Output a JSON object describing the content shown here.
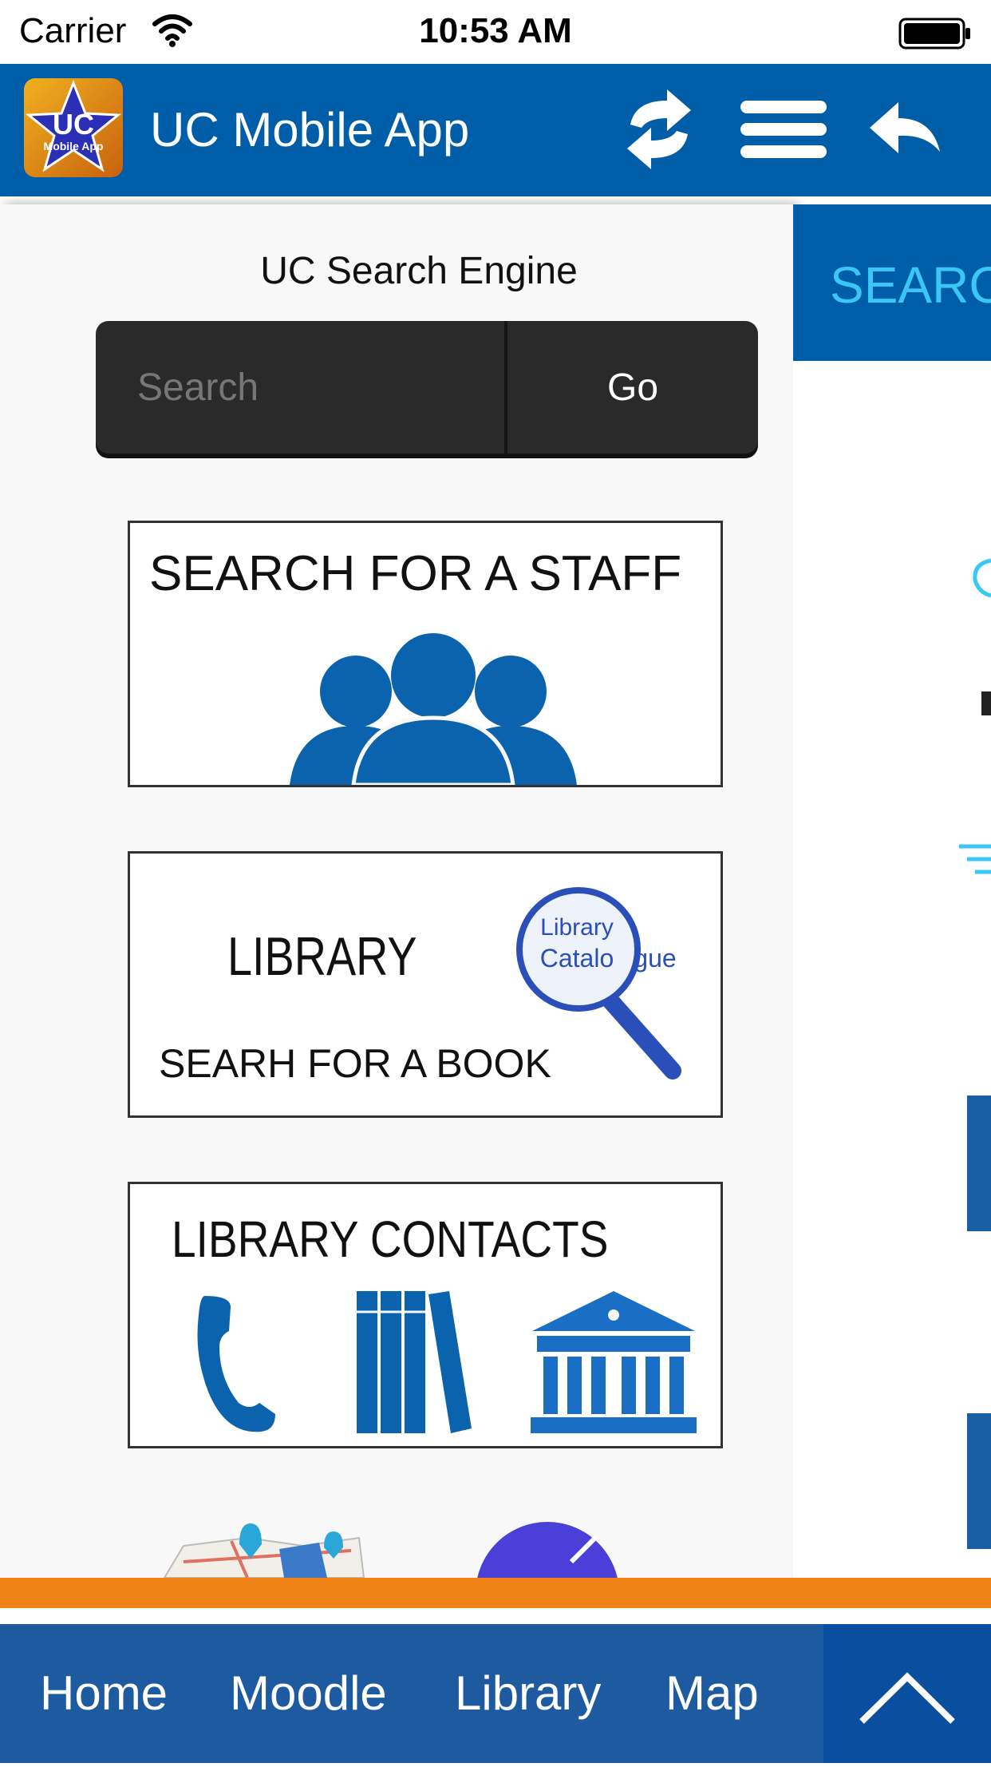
{
  "status_bar": {
    "carrier": "Carrier",
    "time": "10:53 AM"
  },
  "header": {
    "title": "UC Mobile App",
    "logo_text_1": "UC",
    "logo_text_2": "Mobile App",
    "icons": [
      "refresh-icon",
      "menu-icon",
      "back-icon"
    ]
  },
  "search": {
    "title": "UC Search Engine",
    "placeholder": "Search",
    "go_label": "Go"
  },
  "tiles": {
    "staff": {
      "title": "SEARCH FOR A STAFF"
    },
    "library": {
      "title": "LIBRARY",
      "subtitle": "SEARH FOR A BOOK",
      "lens_line1": "Library",
      "lens_line2": "Catalo",
      "lens_suffix": "gue"
    },
    "contacts": {
      "title": "LIBRARY CONTACTS"
    }
  },
  "right_panel": {
    "title": "SEARC"
  },
  "bottom_nav": {
    "items": [
      "Home",
      "Moodle",
      "Library",
      "Map"
    ]
  },
  "colors": {
    "header_blue": "#005ea8",
    "nav_blue": "#1d5aa0",
    "orange": "#f08216",
    "icon_blue": "#0b63ae",
    "accent_cyan": "#3bc7f5"
  }
}
